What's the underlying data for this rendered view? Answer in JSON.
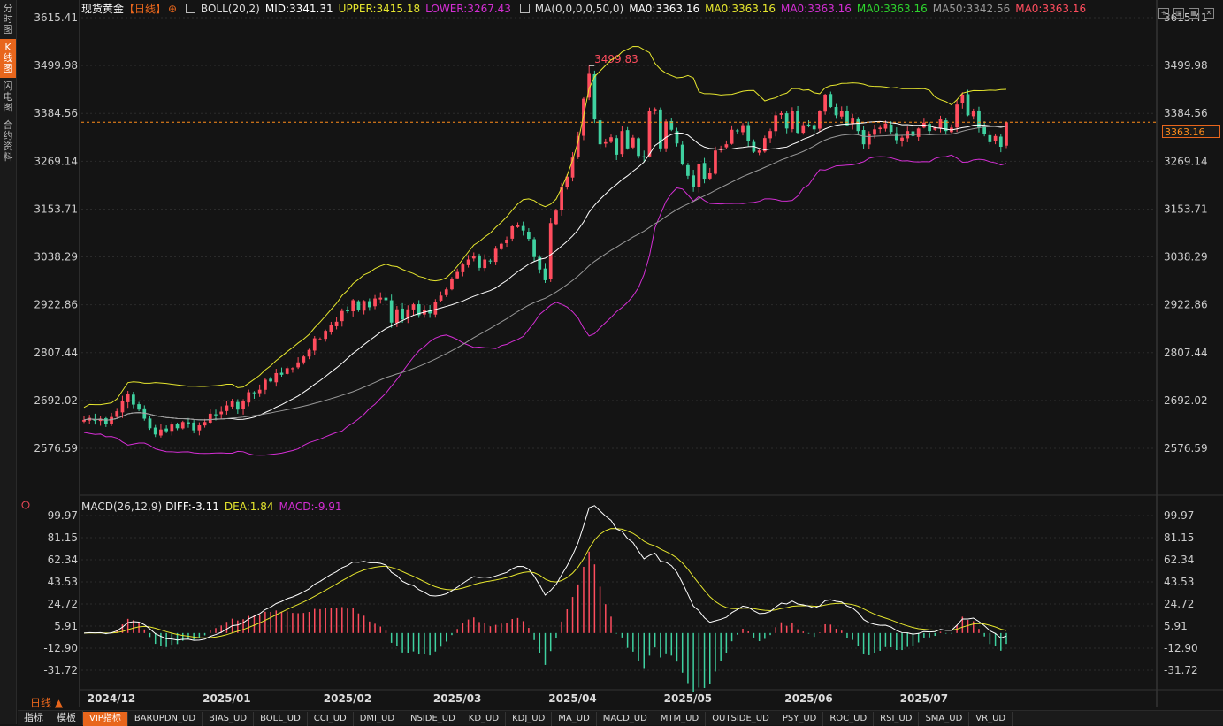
{
  "left_tabs": [
    "分时图",
    "K线图",
    "闪电图",
    "合约资料"
  ],
  "active_tab": 1,
  "header": {
    "symbol": "现货黄金",
    "period": "【日线】",
    "boll": "BOLL(20,2)",
    "mid": "MID:3341.31",
    "upper": "UPPER:3415.18",
    "lower": "LOWER:3267.43",
    "ma_params": "MA(0,0,0,0,50,0)",
    "ma0_a": "MA0:3363.16",
    "ma0_b": "MA0:3363.16",
    "ma0_c": "MA0:3363.16",
    "ma0_d": "MA0:3363.16",
    "ma50": "MA50:3342.56",
    "ma0_e": "MA0:3363.16"
  },
  "macd_header": {
    "title": "MACD(26,12,9)",
    "diff": "DIFF:-3.11",
    "dea": "DEA:1.84",
    "macd": "MACD:-9.91"
  },
  "current_price_label": "3363.16",
  "period_label": "日线 ▲",
  "bottom_tabs": [
    "指标",
    "模板",
    "VIP指标",
    "BARUPDN_UD",
    "BIAS_UD",
    "BOLL_UD",
    "CCI_UD",
    "DMI_UD",
    "INSIDE_UD",
    "KD_UD",
    "KDJ_UD",
    "MA_UD",
    "MACD_UD",
    "MTM_UD",
    "OUTSIDE_UD",
    "PSY_UD",
    "ROC_UD",
    "RSI_UD",
    "SMA_UD",
    "VR_UD"
  ],
  "colors": {
    "up": "#ff4d5e",
    "down": "#3fd1a0",
    "boll_mid": "#ffffff",
    "boll_upper": "#e6e62e",
    "boll_lower": "#d42ed4",
    "ma50": "#999999",
    "current": "#ff8c1a",
    "macd_diff": "#ffffff",
    "macd_dea": "#e6e62e"
  },
  "chart_data": {
    "type": "candlestick",
    "instrument": "现货黄金",
    "period": "日线",
    "price_axis": {
      "ticks": [
        3615.41,
        3499.98,
        3384.56,
        3269.14,
        3153.71,
        3038.29,
        2922.86,
        2807.44,
        2692.02,
        2576.59
      ],
      "tick_labels": [
        "3615.41",
        "3499.98",
        "3384.56",
        "3269.14",
        "3153.71",
        "3038.29",
        "2922.86",
        "2807.44",
        "2692.02",
        "2576.59"
      ],
      "range": [
        2530,
        3615.41
      ]
    },
    "macd_axis": {
      "ticks": [
        99.97,
        81.15,
        62.34,
        43.53,
        24.72,
        5.91,
        -12.9,
        -31.72
      ],
      "tick_labels": [
        "99.97",
        "81.15",
        "62.34",
        "43.53",
        "24.72",
        "5.91",
        "-12.90",
        "-31.72"
      ],
      "range": [
        -45,
        99.97
      ]
    },
    "month_labels": [
      {
        "label": "2024/12",
        "index": 5
      },
      {
        "label": "2025/01",
        "index": 26
      },
      {
        "label": "2025/02",
        "index": 48
      },
      {
        "label": "2025/03",
        "index": 68
      },
      {
        "label": "2025/04",
        "index": 89
      },
      {
        "label": "2025/05",
        "index": 110
      },
      {
        "label": "2025/06",
        "index": 132
      },
      {
        "label": "2025/07",
        "index": 153
      }
    ],
    "max_label": {
      "text": "3499.83",
      "value": 3499.83
    },
    "current_price": 3363.16,
    "closes": [
      2645,
      2650,
      2643,
      2648,
      2636,
      2652,
      2666,
      2690,
      2708,
      2682,
      2670,
      2648,
      2625,
      2610,
      2622,
      2618,
      2634,
      2625,
      2640,
      2636,
      2620,
      2632,
      2640,
      2660,
      2656,
      2665,
      2680,
      2690,
      2670,
      2690,
      2712,
      2710,
      2718,
      2742,
      2738,
      2758,
      2754,
      2770,
      2770,
      2784,
      2798,
      2814,
      2842,
      2840,
      2860,
      2874,
      2882,
      2908,
      2908,
      2934,
      2910,
      2932,
      2917,
      2938,
      2940,
      2934,
      2880,
      2912,
      2888,
      2912,
      2924,
      2898,
      2910,
      2902,
      2930,
      2945,
      2960,
      2984,
      3002,
      3020,
      3032,
      3040,
      3012,
      3032,
      3028,
      3058,
      3070,
      3080,
      3112,
      3115,
      3102,
      3082,
      3038,
      3008,
      2982,
      3120,
      3150,
      3208,
      3232,
      3278,
      3330,
      3420,
      3480,
      3370,
      3310,
      3315,
      3327,
      3285,
      3342,
      3300,
      3326,
      3282,
      3280,
      3390,
      3395,
      3300,
      3365,
      3345,
      3312,
      3262,
      3234,
      3208,
      3262,
      3227,
      3240,
      3295,
      3300,
      3310,
      3345,
      3342,
      3356,
      3318,
      3292,
      3295,
      3325,
      3342,
      3380,
      3385,
      3348,
      3390,
      3338,
      3356,
      3355,
      3346,
      3390,
      3430,
      3400,
      3380,
      3390,
      3356,
      3372,
      3342,
      3310,
      3335,
      3346,
      3350,
      3360,
      3340,
      3320,
      3326,
      3342,
      3330,
      3348,
      3362,
      3342,
      3350,
      3370,
      3342,
      3350,
      3406,
      3430,
      3380,
      3390,
      3350,
      3334,
      3315,
      3330,
      3304,
      3363
    ]
  }
}
